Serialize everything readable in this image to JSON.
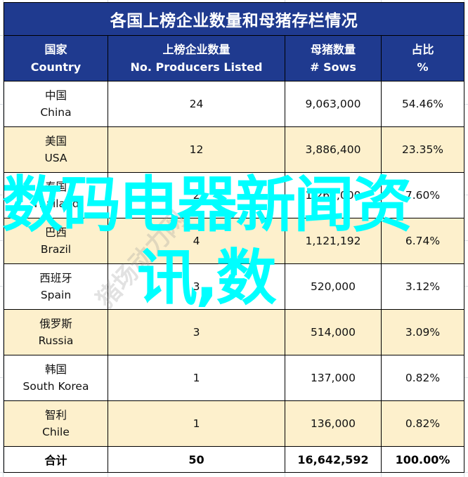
{
  "table": {
    "title": "各国上榜企业数量和母猪存栏情况",
    "headers": [
      {
        "cn": "国家",
        "en": "Country"
      },
      {
        "cn": "上榜企业数量",
        "en": "No. Producers Listed"
      },
      {
        "cn": "母猪数量",
        "en": "# Sows"
      },
      {
        "cn": "占比",
        "en": "%"
      }
    ],
    "rows": [
      {
        "country_cn": "中国",
        "country_en": "China",
        "producers": "24",
        "sows": "9,063,000",
        "share": "54.46%"
      },
      {
        "country_cn": "美国",
        "country_en": "USA",
        "producers": "12",
        "sows": "3,886,400",
        "share": "23.35%"
      },
      {
        "country_cn": "泰国",
        "country_en": "Thailand",
        "producers": "2",
        "sows": "1,265,000",
        "share": "7.60%"
      },
      {
        "country_cn": "巴西",
        "country_en": "Brazil",
        "producers": "4",
        "sows": "1,121,192",
        "share": "6.74%"
      },
      {
        "country_cn": "西班牙",
        "country_en": "Spain",
        "producers": "3",
        "sows": "520,000",
        "share": "3.12%"
      },
      {
        "country_cn": "俄罗斯",
        "country_en": "Russia",
        "producers": "3",
        "sows": "514,000",
        "share": "3.09%"
      },
      {
        "country_cn": "韩国",
        "country_en": "South Korea",
        "producers": "1",
        "sows": "137,000",
        "share": "0.82%"
      },
      {
        "country_cn": "智利",
        "country_en": "Chile",
        "producers": "1",
        "sows": "136,000",
        "share": "0.82%"
      }
    ],
    "total": {
      "label": "合计",
      "producers": "50",
      "sows": "16,642,592",
      "share": "100.00%"
    }
  },
  "watermark_text": "猪场动力网",
  "overlay": {
    "line1": "数码电器新闻资",
    "line2": "讯,数"
  },
  "colors": {
    "header_bg": "#1f3a8f",
    "alt_row_bg": "#fdf0cc",
    "overlay_text": "#00ffff"
  }
}
